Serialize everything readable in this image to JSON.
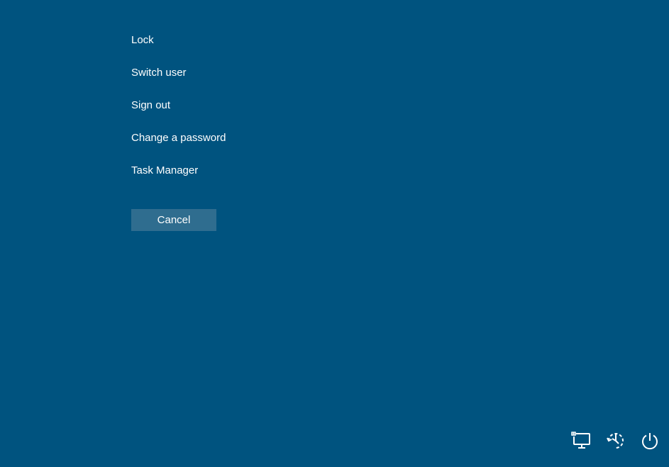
{
  "menu": {
    "items": [
      {
        "label": "Lock"
      },
      {
        "label": "Switch user"
      },
      {
        "label": "Sign out"
      },
      {
        "label": "Change a password"
      },
      {
        "label": "Task Manager"
      }
    ]
  },
  "buttons": {
    "cancel": "Cancel"
  },
  "tray": {
    "network_icon": "network-icon",
    "ease_icon": "ease-of-access-icon",
    "power_icon": "power-icon"
  }
}
